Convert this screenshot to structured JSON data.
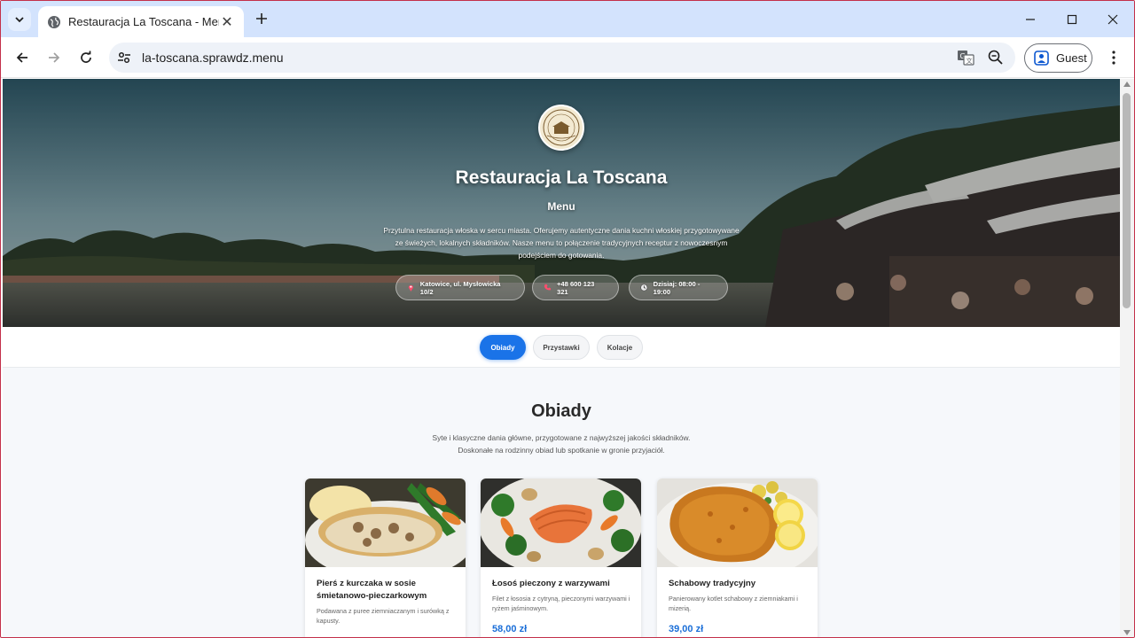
{
  "browser": {
    "tab_title": "Restauracja La Toscana - Menu",
    "url": "la-toscana.sprawdz.menu",
    "profile_label": "Guest"
  },
  "hero": {
    "logo_text": "LA TOSCANA",
    "title": "Restauracja La Toscana",
    "subtitle": "Menu",
    "description": "Przytulna restauracja włoska w sercu miasta. Oferujemy autentyczne dania kuchni włoskiej przygotowywane ze świeżych, lokalnych składników. Nasze menu to połączenie tradycyjnych receptur z nowoczesnym podejściem do gotowania.",
    "address": "Katowice, ul. Mysłowicka 10/2",
    "phone": "+48 600 123 321",
    "hours": "Dzisiaj: 08:00 - 19:00"
  },
  "categories": [
    {
      "label": "Obiady",
      "active": true
    },
    {
      "label": "Przystawki",
      "active": false
    },
    {
      "label": "Kolacje",
      "active": false
    }
  ],
  "section": {
    "title": "Obiady",
    "description_line1": "Syte i klasyczne dania główne, przygotowane z najwyższej jakości składników.",
    "description_line2": "Doskonałe na rodzinny obiad lub spotkanie w gronie przyjaciół."
  },
  "dishes": [
    {
      "name": "Pierś z kurczaka w sosie śmietanowo-pieczarkowym",
      "description": "Podawana z puree ziemniaczanym i surówką z kapusty.",
      "price": "",
      "image": "chicken-mushroom-sauce"
    },
    {
      "name": "Łosoś pieczony z warzywami",
      "description": "Filet z łososia z cytryną, pieczonymi warzywami i ryżem jaśminowym.",
      "price": "58,00 zł",
      "image": "baked-salmon-vegetables"
    },
    {
      "name": "Schabowy tradycyjny",
      "description": "Panierowany kotlet schabowy z ziemniakami i mizerią.",
      "price": "39,00 zł",
      "image": "breaded-pork-cutlet"
    }
  ],
  "colors": {
    "accent": "#1a73e8",
    "price": "#1a6ed8",
    "tabstrip": "#d3e3fd"
  }
}
